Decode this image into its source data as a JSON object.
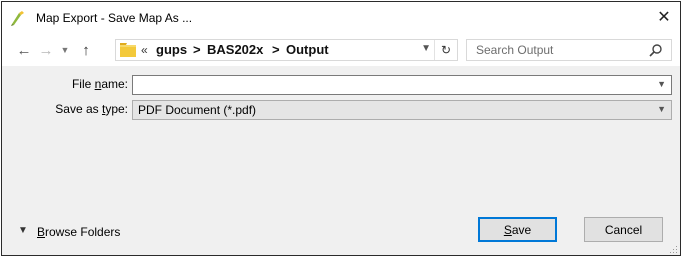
{
  "window": {
    "title": "Map Export - Save Map As ...",
    "close_glyph": "✕"
  },
  "nav": {
    "back_glyph": "←",
    "forward_glyph": "→",
    "recent_glyph": "⌄",
    "up_glyph": "↑",
    "overflow_glyph": "«",
    "breadcrumb": [
      "gups",
      "BAS202x",
      "Output"
    ],
    "separator": ">",
    "dropdown_glyph": "⌄",
    "refresh_glyph": "↻"
  },
  "search": {
    "placeholder": "Search Output",
    "icon": "search-icon"
  },
  "form": {
    "file_name_label_pre": "File ",
    "file_name_label_accel": "n",
    "file_name_label_post": "ame:",
    "file_name_value": "",
    "save_type_label_pre": "Save as ",
    "save_type_label_accel": "t",
    "save_type_label_post": "ype:",
    "save_type_value": "PDF Document (*.pdf)",
    "combo_arrow": "⌄"
  },
  "footer": {
    "browse_chevron": "⌄",
    "browse_accel": "B",
    "browse_rest": "rowse Folders",
    "save_accel": "S",
    "save_rest": "ave",
    "cancel_label": "Cancel"
  },
  "colors": {
    "accent": "#0078d7",
    "folder": "#f3c93b",
    "panel": "#f0f0f0"
  }
}
